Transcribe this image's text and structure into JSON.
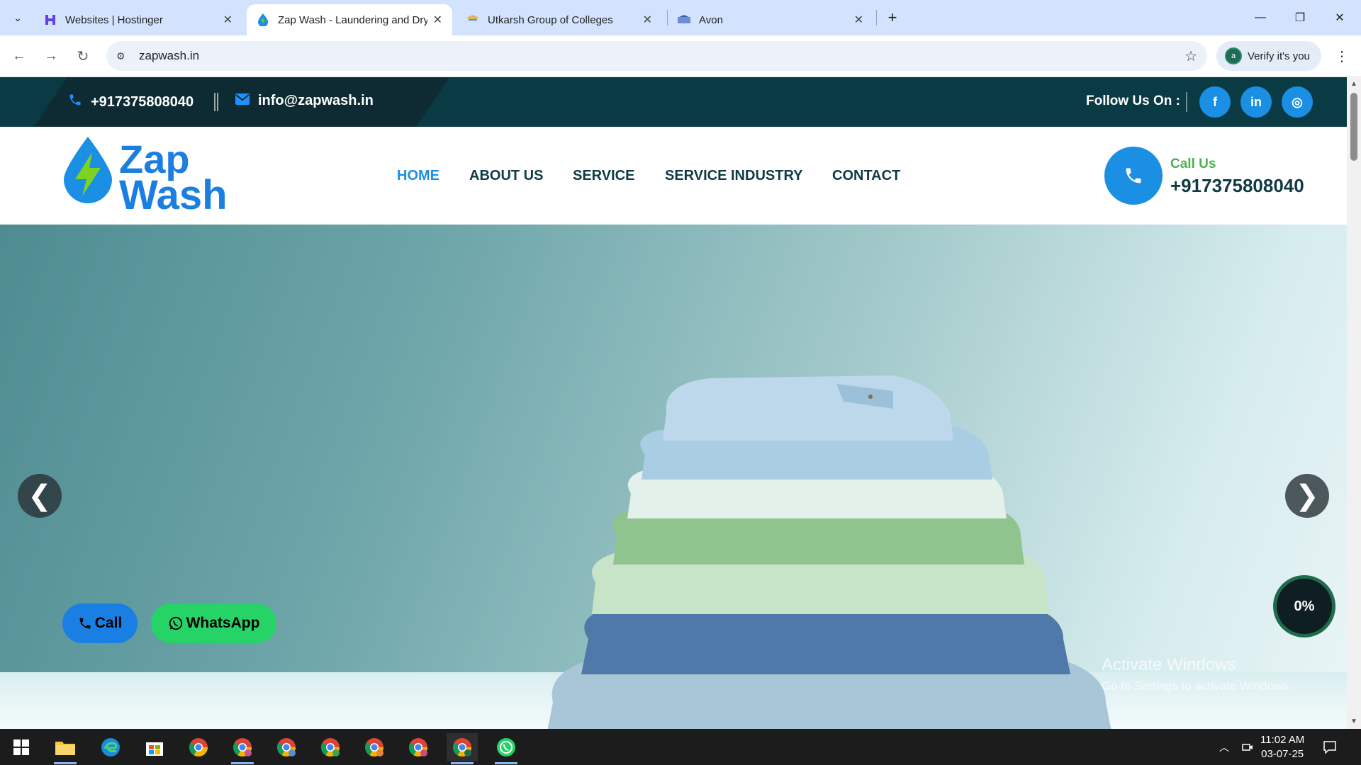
{
  "browser": {
    "tabs": [
      {
        "title": "Websites | Hostinger"
      },
      {
        "title": "Zap Wash - Laundering and Dry"
      },
      {
        "title": "Utkarsh Group of Colleges"
      },
      {
        "title": "Avon"
      }
    ],
    "url": "zapwash.in",
    "verify_label": "Verify it's you",
    "verify_avatar": "a"
  },
  "site": {
    "topbar": {
      "phone": "+917375808040",
      "email": "info@zapwash.in",
      "follow_label": "Follow Us On :",
      "social": [
        {
          "icon": "facebook-icon",
          "glyph": "f"
        },
        {
          "icon": "linkedin-icon",
          "glyph": "in"
        },
        {
          "icon": "instagram-icon",
          "glyph": "◎"
        }
      ]
    },
    "logo": {
      "line1": "Zap",
      "line2": "Wash"
    },
    "nav": [
      {
        "label": "HOME",
        "active": true
      },
      {
        "label": "ABOUT US"
      },
      {
        "label": "SERVICE"
      },
      {
        "label": "SERVICE INDUSTRY"
      },
      {
        "label": "CONTACT"
      }
    ],
    "call": {
      "label": "Call Us",
      "number": "+917375808040"
    },
    "hero": {
      "prev": "❮",
      "next": "❯"
    },
    "floating": {
      "call_label": "Call",
      "whatsapp_label": "WhatsApp",
      "progress": "0%"
    },
    "watermark": {
      "line1": "Activate Windows",
      "line2": "Go to Settings to activate Windows."
    }
  },
  "taskbar": {
    "time": "11:02 AM",
    "date": "03-07-25"
  },
  "colors": {
    "brand_blue": "#1a8fe3",
    "dark_teal": "#0a3a43",
    "accent_green": "#4caf50",
    "whatsapp_green": "#25d366"
  }
}
